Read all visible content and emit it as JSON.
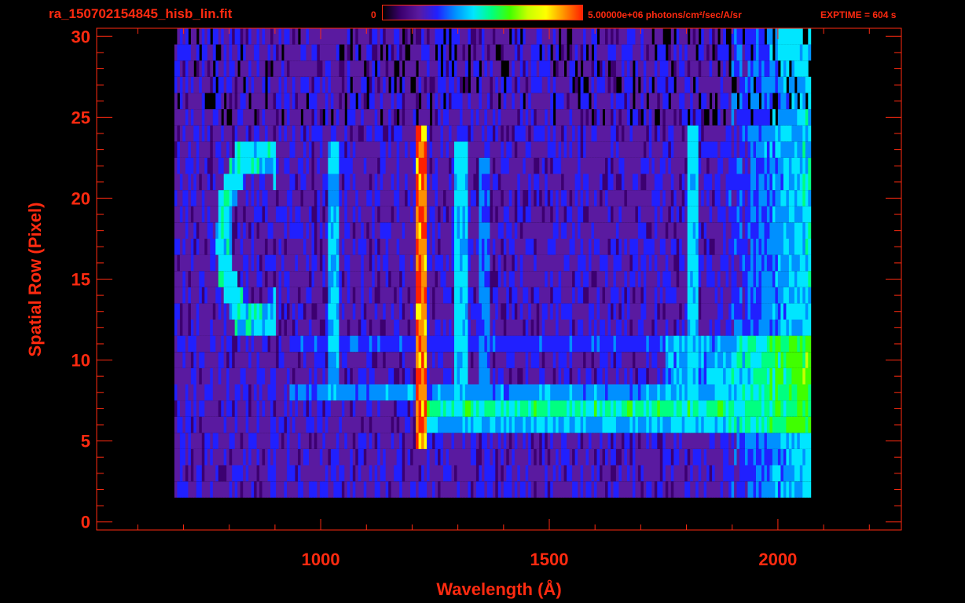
{
  "header": {
    "filename": "ra_150702154845_hisb_lin.fit",
    "colorbar_min": "0",
    "colorbar_max": "5.00000e+06 photons/cm²/sec/A/sr",
    "exptime": "EXPTIME = 604 s"
  },
  "colors": {
    "axis": "#ff2a10",
    "background": "#000000",
    "colormap": [
      "#000000",
      "#3c0070",
      "#5a1aa0",
      "#2020ff",
      "#0090ff",
      "#00e6ff",
      "#00ff80",
      "#40ff00",
      "#c8ff00",
      "#ffff00",
      "#ff9000",
      "#ff2000"
    ]
  },
  "chart_data": {
    "type": "heatmap",
    "title": "ra_150702154845_hisb_lin.fit",
    "xlabel": "Wavelength (Å)",
    "ylabel": "Spatial Row (Pixel)",
    "xlim": [
      510,
      2270
    ],
    "ylim": [
      -0.5,
      30.5
    ],
    "x_ticks": [
      1000,
      1500,
      2000
    ],
    "y_ticks": [
      0,
      5,
      10,
      15,
      20,
      25,
      30
    ],
    "colorbar_range": [
      0,
      5000000
    ],
    "colorbar_units": "photons/cm²/sec/A/sr",
    "grid": false,
    "rows": 31,
    "features": [
      {
        "kind": "arc",
        "center_wavelength": 860,
        "center_row": 17.5,
        "radius_wavelength": 75,
        "radius_row": 5.3,
        "level": 0.45
      },
      {
        "kind": "vertical_line",
        "wavelength": 1026,
        "rows": [
          8,
          23
        ],
        "level": 0.42
      },
      {
        "kind": "vertical_line",
        "wavelength": 1216,
        "rows": [
          5,
          24
        ],
        "level": 0.95
      },
      {
        "kind": "vertical_line",
        "wavelength": 1304,
        "rows": [
          8,
          23
        ],
        "level": 0.45
      },
      {
        "kind": "vertical_line",
        "wavelength": 1356,
        "rows": [
          8,
          22
        ],
        "level": 0.35
      },
      {
        "kind": "vertical_line",
        "wavelength": 1810,
        "rows": [
          8,
          24
        ],
        "level": 0.45
      },
      {
        "kind": "horizontal_band",
        "row": 6,
        "wavelengths": [
          1230,
          2060
        ],
        "level": 0.42
      },
      {
        "kind": "horizontal_band",
        "row": 7,
        "wavelengths": [
          1230,
          2060
        ],
        "level": 0.55
      },
      {
        "kind": "horizontal_band",
        "row": 8,
        "wavelengths": [
          930,
          2060
        ],
        "level": 0.38
      },
      {
        "kind": "horizontal_band",
        "row": 11,
        "wavelengths": [
          930,
          2060
        ],
        "level": 0.3
      }
    ],
    "data_extent": {
      "wavelength": [
        680,
        2070
      ],
      "rows": [
        2,
        30
      ]
    }
  }
}
